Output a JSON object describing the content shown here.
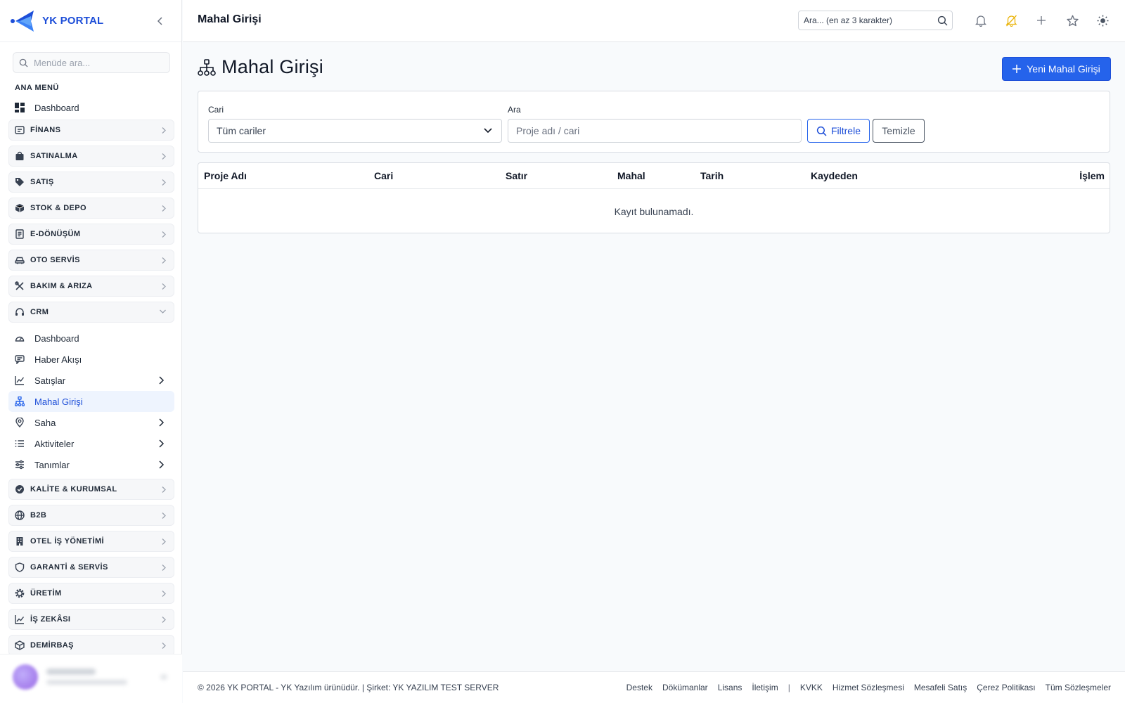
{
  "brand": {
    "name": "YK PORTAL"
  },
  "sidebar": {
    "search_placeholder": "Menüde ara...",
    "section_title": "ANA MENÜ",
    "dashboard": "Dashboard",
    "groups_top": [
      {
        "label": "FİNANS",
        "icon": "finance-icon"
      },
      {
        "label": "SATINALMA",
        "icon": "bag-icon"
      },
      {
        "label": "SATIŞ",
        "icon": "tag-icon"
      },
      {
        "label": "STOK & DEPO",
        "icon": "box-icon"
      },
      {
        "label": "E-DÖNÜŞÜM",
        "icon": "document-icon"
      },
      {
        "label": "OTO SERVİS",
        "icon": "car-icon"
      },
      {
        "label": "BAKIM & ARIZA",
        "icon": "tools-icon"
      },
      {
        "label": "CRM",
        "icon": "headset-icon",
        "expanded": true
      }
    ],
    "crm_items": [
      {
        "label": "Dashboard",
        "icon": "gauge-icon",
        "has_children": false
      },
      {
        "label": "Haber Akışı",
        "icon": "message-icon",
        "has_children": false
      },
      {
        "label": "Satışlar",
        "icon": "chart-line-icon",
        "has_children": true
      },
      {
        "label": "Mahal Girişi",
        "icon": "sitemap-icon",
        "has_children": false,
        "active": true
      },
      {
        "label": "Saha",
        "icon": "map-pin-icon",
        "has_children": true
      },
      {
        "label": "Aktiviteler",
        "icon": "list-icon",
        "has_children": true
      },
      {
        "label": "Tanımlar",
        "icon": "sliders-icon",
        "has_children": true
      }
    ],
    "groups_bottom": [
      {
        "label": "KALİTE & KURUMSAL",
        "icon": "badge-check-icon"
      },
      {
        "label": "B2B",
        "icon": "globe-icon"
      },
      {
        "label": "OTEL İŞ YÖNETİMİ",
        "icon": "building-icon"
      },
      {
        "label": "GARANTİ & SERVİS",
        "icon": "shield-icon"
      },
      {
        "label": "ÜRETİM",
        "icon": "gear-icon"
      },
      {
        "label": "İŞ ZEKÂSI",
        "icon": "chart-icon"
      },
      {
        "label": "DEMİRBAŞ",
        "icon": "cube-icon"
      }
    ]
  },
  "header": {
    "title": "Mahal Girişi",
    "search_placeholder": "Ara... (en az 3 karakter)"
  },
  "page": {
    "title": "Mahal Girişi",
    "new_button": "Yeni Mahal Girişi"
  },
  "filters": {
    "cari_label": "Cari",
    "cari_value": "Tüm cariler",
    "ara_label": "Ara",
    "ara_placeholder": "Proje adı / cari",
    "filter_button": "Filtrele",
    "clear_button": "Temizle"
  },
  "table": {
    "columns": [
      "Proje Adı",
      "Cari",
      "Satır",
      "Mahal",
      "Tarih",
      "Kaydeden",
      "İşlem"
    ],
    "empty_text": "Kayıt bulunamadı."
  },
  "footer": {
    "copyright": "© 2026 YK PORTAL - YK Yazılım ürünüdür. | Şirket: YK YAZILIM TEST SERVER",
    "links_left": [
      "Destek",
      "Dökümanlar",
      "Lisans",
      "İletişim"
    ],
    "separator": "|",
    "links_right": [
      "KVKK",
      "Hizmet Sözleşmesi",
      "Mesafeli Satış",
      "Çerez Politikası",
      "Tüm Sözleşmeler"
    ]
  },
  "colors": {
    "primary": "#2563eb",
    "active_bg": "#eef4fe",
    "accent_bell": "#eab308"
  }
}
